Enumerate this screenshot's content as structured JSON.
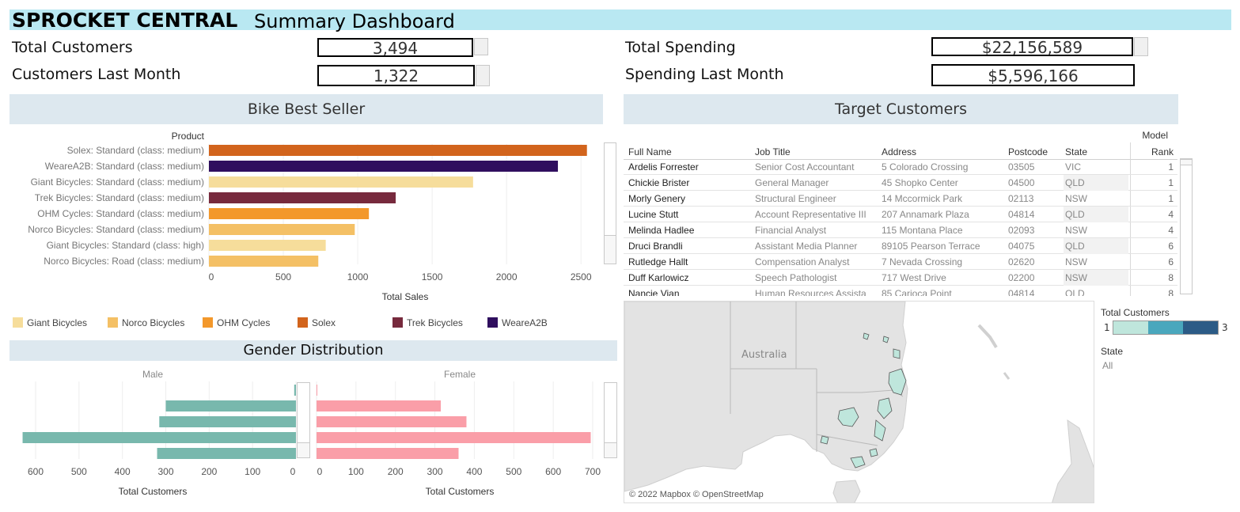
{
  "header": {
    "app_title": "SPROCKET CENTRAL",
    "dashboard_title": "Summary Dashboard",
    "background": "#b9e8f2"
  },
  "kpis": {
    "total_customers": {
      "label": "Total Customers",
      "value": "3,494"
    },
    "customers_last_month": {
      "label": "Customers Last Month",
      "value": "1,322"
    },
    "total_spending": {
      "label": "Total Spending",
      "value": "$22,156,589"
    },
    "spending_last_month": {
      "label": "Spending Last Month",
      "value": "$5,596,166"
    }
  },
  "sections": {
    "bike_best_seller": "Bike Best Seller",
    "target_customers": "Target Customers",
    "gender_distribution": "Gender Distribution"
  },
  "colors": {
    "Giant Bicycles": "#f6dd9b",
    "Norco Bicycles": "#f4c065",
    "OHM Cycles": "#f3982b",
    "Solex": "#d2641c",
    "Trek Bicycles": "#772a3d",
    "WeareA2B": "#2f0e5e",
    "male": "#78b8ad",
    "female": "#fa9ea8",
    "section_bg": "#dde8ef"
  },
  "chart_data": [
    {
      "type": "bar",
      "title": "Bike Best Seller",
      "orientation": "horizontal",
      "category_header": "Product",
      "categories": [
        "Solex: Standard (class: medium)",
        "WeareA2B: Standard (class: medium)",
        "Giant Bicycles: Standard (class: medium)",
        "Trek Bicycles: Standard (class: medium)",
        "OHM Cycles: Standard (class: medium)",
        "Norco Bicycles: Standard (class: medium)",
        "Giant Bicycles: Standard (class: high)",
        "Norco Bicycles: Road (class: medium)"
      ],
      "brands": [
        "Solex",
        "WeareA2B",
        "Giant Bicycles",
        "Trek Bicycles",
        "OHM Cycles",
        "Norco Bicycles",
        "Giant Bicycles",
        "Norco Bicycles"
      ],
      "values": [
        2540,
        2345,
        1775,
        1255,
        1075,
        980,
        785,
        735
      ],
      "xlabel": "Total Sales",
      "xlim": [
        0,
        2600
      ],
      "xticks": [
        "0",
        "500",
        "1000",
        "1500",
        "2000",
        "2500"
      ],
      "xtick_values": [
        0,
        500,
        1000,
        1500,
        2000,
        2500
      ],
      "legend": {
        "placement": "bottom",
        "entries": [
          "Giant Bicycles",
          "Norco Bicycles",
          "OHM Cycles",
          "Solex",
          "Trek Bicycles",
          "WeareA2B"
        ]
      },
      "grid": true
    },
    {
      "type": "bar",
      "title": "Gender Distribution",
      "orientation": "horizontal-mirrored",
      "series": [
        {
          "name": "Male",
          "values": [
            4,
            300,
            315,
            630,
            320
          ]
        },
        {
          "name": "Female",
          "values": [
            2,
            315,
            380,
            695,
            360
          ]
        }
      ],
      "male_xlabel": "Total Customers",
      "female_xlabel": "Total Customers",
      "male_xticks": [
        "600",
        "500",
        "400",
        "300",
        "200",
        "100",
        "0"
      ],
      "male_xtick_values": [
        600,
        500,
        400,
        300,
        200,
        100,
        0
      ],
      "female_xticks": [
        "0",
        "100",
        "200",
        "300",
        "400",
        "500",
        "600",
        "700"
      ],
      "female_xtick_values": [
        0,
        100,
        200,
        300,
        400,
        500,
        600,
        700
      ],
      "male_xlim": [
        0,
        630
      ],
      "female_xlim": [
        0,
        760
      ],
      "grid": true
    }
  ],
  "target_customers": {
    "columns": {
      "name": "Full Name",
      "job": "Job Title",
      "address": "Address",
      "postcode": "Postcode",
      "state": "State",
      "rank_top": "Model",
      "rank_bottom": "Rank"
    },
    "rows": [
      {
        "name": "Ardelis Forrester",
        "job": "Senior Cost Accountant",
        "address": "5 Colorado Crossing",
        "postcode": "03505",
        "state": "VIC",
        "rank": "1"
      },
      {
        "name": "Chickie Brister",
        "job": "General Manager",
        "address": "45 Shopko Center",
        "postcode": "04500",
        "state": "QLD",
        "rank": "1"
      },
      {
        "name": "Morly Genery",
        "job": "Structural Engineer",
        "address": "14 Mccormick Park",
        "postcode": "02113",
        "state": "NSW",
        "rank": "1"
      },
      {
        "name": "Lucine Stutt",
        "job": "Account Representative III",
        "address": "207 Annamark Plaza",
        "postcode": "04814",
        "state": "QLD",
        "rank": "4"
      },
      {
        "name": "Melinda Hadlee",
        "job": "Financial Analyst",
        "address": "115 Montana Place",
        "postcode": "02093",
        "state": "NSW",
        "rank": "4"
      },
      {
        "name": "Druci Brandli",
        "job": "Assistant Media Planner",
        "address": "89105 Pearson Terrace",
        "postcode": "04075",
        "state": "QLD",
        "rank": "6"
      },
      {
        "name": "Rutledge Hallt",
        "job": "Compensation Analyst",
        "address": "7 Nevada Crossing",
        "postcode": "02620",
        "state": "NSW",
        "rank": "6"
      },
      {
        "name": "Duff Karlowicz",
        "job": "Speech Pathologist",
        "address": "717 West Drive",
        "postcode": "02200",
        "state": "NSW",
        "rank": "8"
      },
      {
        "name": "Nancie Vian",
        "job": "Human Resources Assista",
        "address": "85 Carioca Point",
        "postcode": "04814",
        "state": "QLD",
        "rank": "8"
      }
    ]
  },
  "map": {
    "country_label": "Australia",
    "attribution": "© 2022 Mapbox © OpenStreetMap",
    "legend_title": "Total Customers",
    "legend_min": "1",
    "legend_max": "3",
    "legend_colors": [
      "#bfe6dc",
      "#4aa7bd",
      "#2c5b86"
    ],
    "state_filter_title": "State",
    "state_filter_value": "All"
  }
}
